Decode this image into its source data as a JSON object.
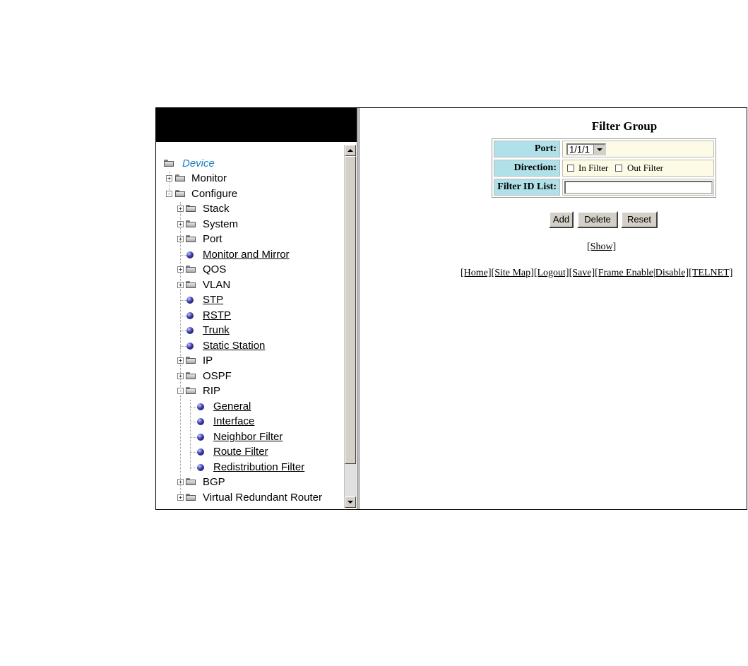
{
  "tree": {
    "items": [
      {
        "label": "Device",
        "kind": "root"
      },
      {
        "label": "Monitor",
        "kind": "folder",
        "expander": "+"
      },
      {
        "label": "Configure",
        "kind": "folder",
        "expander": "-"
      },
      {
        "label": "Stack",
        "kind": "folder",
        "expander": "+"
      },
      {
        "label": "System",
        "kind": "folder",
        "expander": "+"
      },
      {
        "label": "Port",
        "kind": "folder",
        "expander": "+"
      },
      {
        "label": "Monitor and Mirror",
        "kind": "link"
      },
      {
        "label": "QOS",
        "kind": "folder",
        "expander": "+"
      },
      {
        "label": "VLAN",
        "kind": "folder",
        "expander": "+"
      },
      {
        "label": "STP",
        "kind": "link"
      },
      {
        "label": "RSTP",
        "kind": "link"
      },
      {
        "label": "Trunk",
        "kind": "link"
      },
      {
        "label": "Static Station",
        "kind": "link"
      },
      {
        "label": "IP",
        "kind": "folder",
        "expander": "+"
      },
      {
        "label": "OSPF",
        "kind": "folder",
        "expander": "+"
      },
      {
        "label": "RIP",
        "kind": "folder",
        "expander": "-"
      },
      {
        "label": "General",
        "kind": "link"
      },
      {
        "label": "Interface",
        "kind": "link"
      },
      {
        "label": "Neighbor Filter",
        "kind": "link"
      },
      {
        "label": "Route Filter",
        "kind": "link"
      },
      {
        "label": "Redistribution Filter",
        "kind": "link"
      },
      {
        "label": "BGP",
        "kind": "folder",
        "expander": "+"
      },
      {
        "label": "Virtual Redundant Router",
        "kind": "folder",
        "expander": "+"
      }
    ]
  },
  "form": {
    "title": "Filter Group",
    "port_label": "Port:",
    "port_value": "1/1/1",
    "direction_label": "Direction:",
    "in_filter": "In Filter",
    "out_filter": "Out Filter",
    "filter_id_label": "Filter ID List:",
    "filter_id_value": ""
  },
  "buttons": {
    "add": "Add",
    "delete": "Delete",
    "reset": "Reset"
  },
  "show_link": "[Show]",
  "nav_links": [
    "[Home]",
    "[Site Map]",
    "[Logout]",
    "[Save]",
    "[Frame Enable",
    "|Disable]",
    "[TELNET]"
  ],
  "colors": {
    "label_bg": "#b0e0e8",
    "value_bg": "#fdfae6",
    "banner": "#000000",
    "device_text": "#1a7fc4"
  }
}
